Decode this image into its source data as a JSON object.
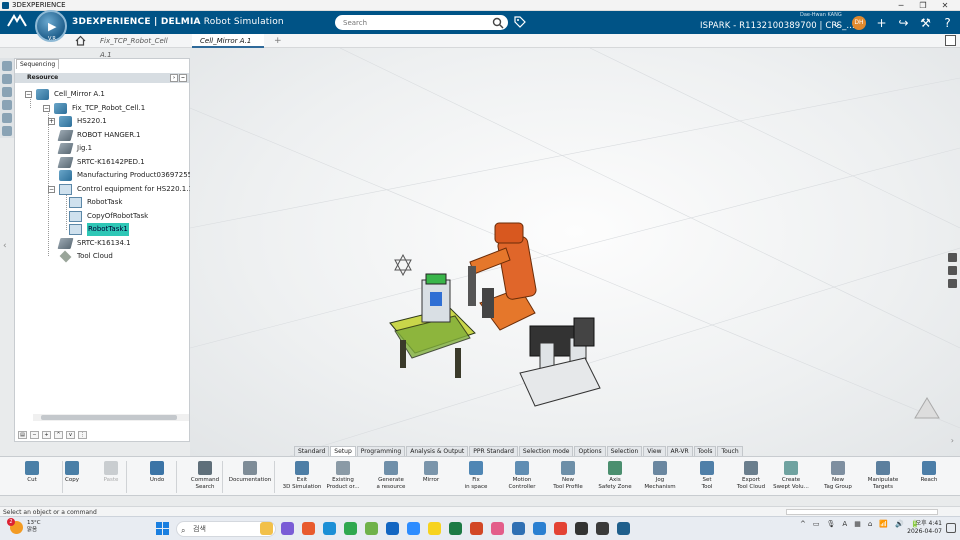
{
  "window": {
    "title": "3DEXPERIENCE",
    "minimize": "─",
    "restore": "❐",
    "close": "✕"
  },
  "topbar": {
    "ds_logo": "3DS",
    "brand_main": "3DEXPERIENCE | DELMIA",
    "brand_app": "Robot Simulation",
    "search_placeholder": "Search",
    "user_name": "Dae-Hwan KANG",
    "tenant": "ISPARK - R1132100389700 | CPS_...",
    "avatar_initials": "DH",
    "icons": [
      "plus-icon",
      "share-icon",
      "compass-tools-icon",
      "help-icon"
    ],
    "icon_glyphs": {
      "chevron": "⌄",
      "plus": "+",
      "share": "↪",
      "tools": "⚒",
      "help": "?"
    }
  },
  "compass": {
    "play": "▶",
    "version": "V.R"
  },
  "tabs": [
    {
      "label": "Fix_TCP_Robot_Cell A.1",
      "active": false
    },
    {
      "label": "Cell_Mirror A.1",
      "active": true
    }
  ],
  "tab_add": "+",
  "panel": {
    "tab": "Sequencing",
    "header": "Resource",
    "tree": [
      {
        "label": "Cell_Mirror A.1",
        "icon": "product-icon",
        "expander": "−"
      },
      {
        "label": "Fix_TCP_Robot_Cell.1",
        "icon": "product-icon",
        "expander": "−"
      },
      {
        "label": "HS220.1",
        "icon": "robot-icon",
        "expander": "+"
      },
      {
        "label": "ROBOT HANGER.1",
        "icon": "resource-icon"
      },
      {
        "label": "Jig.1",
        "icon": "resource-icon"
      },
      {
        "label": "SRTC-K16142PED.1",
        "icon": "resource-icon"
      },
      {
        "label": "Manufacturing Product03697255.",
        "icon": "product-icon"
      },
      {
        "label": "Control equipment for HS220.1.1",
        "icon": "controller-icon",
        "expander": "−"
      },
      {
        "label": "RobotTask",
        "icon": "task-icon"
      },
      {
        "label": "CopyOfRobotTask",
        "icon": "task-icon"
      },
      {
        "label": "RobotTask1",
        "icon": "task-icon",
        "selected": true
      },
      {
        "label": "SRTC-K16134.1",
        "icon": "resource-icon"
      },
      {
        "label": "Tool Cloud",
        "icon": "cloud-icon"
      }
    ]
  },
  "actionbar_tabs": [
    "Standard",
    "Setup",
    "Programming",
    "Analysis & Output",
    "PPR Standard",
    "Selection mode",
    "Options",
    "Selection",
    "View",
    "AR-VR",
    "Tools",
    "Touch"
  ],
  "actionbar_active": "Setup",
  "actions": [
    {
      "label": "Cut",
      "icon": "scissors-icon",
      "color": "#4a7fa7"
    },
    {
      "label": "Copy",
      "icon": "copy-icon",
      "color": "#4a7fa7"
    },
    {
      "label": "Paste",
      "icon": "paste-icon",
      "color": "#c9cdd0",
      "disabled": true
    },
    {
      "label": "Undo",
      "icon": "undo-icon",
      "color": "#3b74a6"
    },
    {
      "label": "Command\nSearch",
      "icon": "command-search-icon",
      "color": "#5f6f7a"
    },
    {
      "label": "Documentation",
      "icon": "documentation-icon",
      "color": "#7e8c97"
    },
    {
      "label": "Exit\n3D Simulation",
      "icon": "exit-simulation-icon",
      "color": "#4d7ea6"
    },
    {
      "label": "Existing\nProduct or...",
      "icon": "existing-product-icon",
      "color": "#8a9aa6"
    },
    {
      "label": "Generate\na resource",
      "icon": "generate-resource-icon",
      "color": "#6f8fa9"
    },
    {
      "label": "Mirror",
      "icon": "mirror-icon",
      "color": "#7a95ab"
    },
    {
      "label": "Fix\nin space",
      "icon": "fix-in-space-icon",
      "color": "#4f86b4"
    },
    {
      "label": "Motion\nController",
      "icon": "motion-controller-icon",
      "color": "#5f8db3"
    },
    {
      "label": "New\nTool Profile",
      "icon": "tool-profile-icon",
      "color": "#6d8fa8"
    },
    {
      "label": "Axis\nSafety Zone",
      "icon": "axis-safety-zone-icon",
      "color": "#4b8f6f"
    },
    {
      "label": "Jog\nMechanism",
      "icon": "jog-mechanism-icon",
      "color": "#6a87a0"
    },
    {
      "label": "Set\nTool",
      "icon": "set-tool-icon",
      "color": "#4f7fa8"
    },
    {
      "label": "Export\nTool Cloud",
      "icon": "export-tool-cloud-icon",
      "color": "#6a7e8d"
    },
    {
      "label": "Create\nSwept Volu...",
      "icon": "swept-volume-icon",
      "color": "#6fa2a0"
    },
    {
      "label": "New\nTag Group",
      "icon": "tag-group-icon",
      "color": "#7e8fa0"
    },
    {
      "label": "Manipulate\nTargets",
      "icon": "manipulate-targets-icon",
      "color": "#5b7f9e"
    },
    {
      "label": "Reach",
      "icon": "reach-icon",
      "color": "#4c7ea8"
    }
  ],
  "status": {
    "text": "Select an object or a command"
  },
  "taskbar": {
    "weather_temp": "13°C",
    "weather_desc": "맑음",
    "weather_badge": "2",
    "search_label": "검색",
    "apps": [
      {
        "name": "file-explorer-icon",
        "color": "#f2c04a"
      },
      {
        "name": "store-icon",
        "color": "#7a5cd6"
      },
      {
        "name": "settings-flower-icon",
        "color": "#e85a2e"
      },
      {
        "name": "edge-icon",
        "color": "#1c8fd6"
      },
      {
        "name": "chrome-icon",
        "color": "#2fa84f"
      },
      {
        "name": "notes-icon",
        "color": "#6fb24a"
      },
      {
        "name": "outlook-icon",
        "color": "#1366c2"
      },
      {
        "name": "zoom-icon",
        "color": "#2d8cff"
      },
      {
        "name": "kakaotalk-icon",
        "color": "#f7d31f"
      },
      {
        "name": "excel-icon",
        "color": "#1d7a45"
      },
      {
        "name": "powerpoint-icon",
        "color": "#d24726"
      },
      {
        "name": "paint-icon",
        "color": "#e35d8a"
      },
      {
        "name": "remote-desktop-icon",
        "color": "#2f6fb3"
      },
      {
        "name": "vs-code-icon",
        "color": "#2a7fd1"
      },
      {
        "name": "chrome-icon-2",
        "color": "#e34234"
      },
      {
        "name": "terminal-icon",
        "color": "#333333"
      },
      {
        "name": "snipping-icon",
        "color": "#3a3a3a"
      },
      {
        "name": "3dexperience-icon",
        "color": "#1f5f8c"
      }
    ],
    "tray": [
      "^",
      "▭",
      "🎙",
      "A",
      "▦",
      "⌂",
      "📶",
      "🔊",
      "🔋"
    ],
    "time": "오후 4:41",
    "date": "2026-04-07"
  },
  "colors": {
    "brand_bar": "#005386",
    "selection": "#2ec7b6",
    "robot": "#e06a24"
  }
}
